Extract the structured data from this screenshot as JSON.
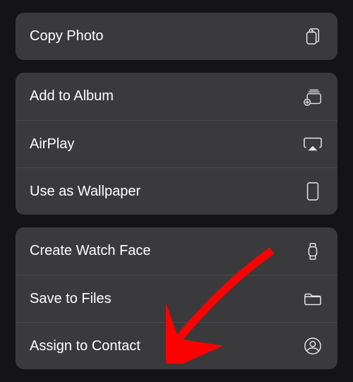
{
  "menu": {
    "group1": [
      {
        "label": "Copy Photo",
        "icon": "copy-icon"
      }
    ],
    "group2": [
      {
        "label": "Add to Album",
        "icon": "album-add-icon"
      },
      {
        "label": "AirPlay",
        "icon": "airplay-icon"
      },
      {
        "label": "Use as Wallpaper",
        "icon": "phone-icon"
      }
    ],
    "group3": [
      {
        "label": "Create Watch Face",
        "icon": "watch-icon"
      },
      {
        "label": "Save to Files",
        "icon": "folder-icon"
      },
      {
        "label": "Assign to Contact",
        "icon": "contact-icon"
      }
    ]
  },
  "annotation": {
    "color": "#ff0000"
  }
}
